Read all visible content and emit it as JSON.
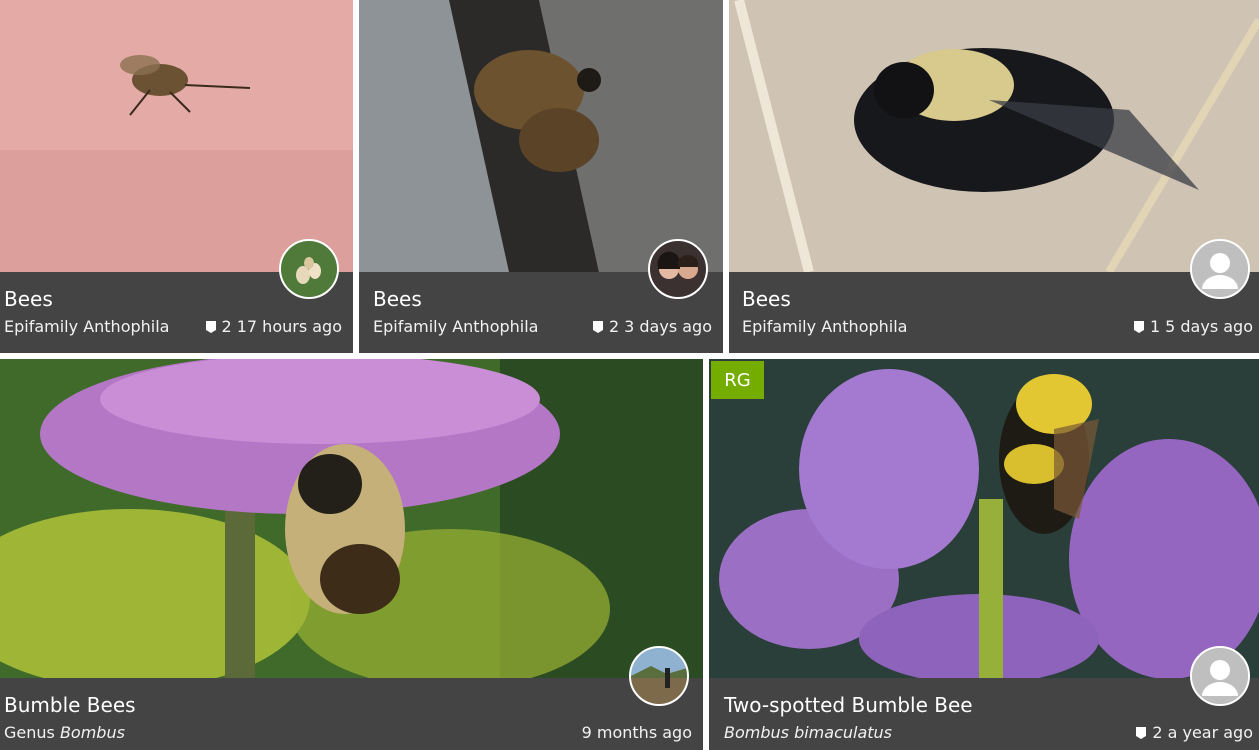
{
  "observations": [
    {
      "common_name": "Bees",
      "rank": "Epifamily",
      "scientific_name": "Anthophila",
      "italic": false,
      "comments": "2",
      "time": "17 hours ago",
      "user_avatar": "observer-photo-mushrooms",
      "rg": false
    },
    {
      "common_name": "Bees",
      "rank": "Epifamily",
      "scientific_name": "Anthophila",
      "italic": false,
      "comments": "2",
      "time": "3 days ago",
      "user_avatar": "observer-photo-couple",
      "rg": false
    },
    {
      "common_name": "Bees",
      "rank": "Epifamily",
      "scientific_name": "Anthophila",
      "italic": false,
      "comments": "1",
      "time": "5 days ago",
      "user_avatar": "default-user-icon",
      "rg": false
    },
    {
      "common_name": "Bumble Bees",
      "rank": "Genus",
      "scientific_name": "Bombus",
      "italic": true,
      "comments": "",
      "time": "9 months ago",
      "user_avatar": "observer-photo-trail",
      "rg": false
    },
    {
      "common_name": "Two-spotted Bumble Bee",
      "rank": "",
      "scientific_name": "Bombus bimaculatus",
      "italic": true,
      "comments": "2",
      "time": "a year ago",
      "user_avatar": "default-user-icon",
      "rg": true,
      "rg_label": "RG"
    }
  ]
}
